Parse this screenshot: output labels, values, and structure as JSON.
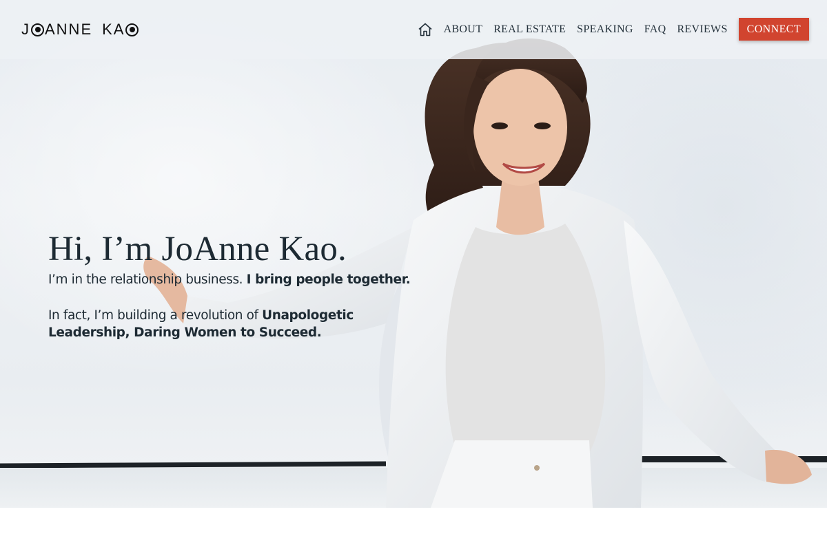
{
  "brand": {
    "logo_text_1": "J",
    "logo_text_2": "ANNE",
    "logo_text_3": "KA",
    "accent_color": "#d1442f"
  },
  "nav": {
    "home_icon": "home-icon",
    "items": [
      {
        "label": "ABOUT"
      },
      {
        "label": "REAL ESTATE"
      },
      {
        "label": "SPEAKING"
      },
      {
        "label": "FAQ"
      },
      {
        "label": "REVIEWS"
      }
    ],
    "cta_label": "CONNECT"
  },
  "hero": {
    "title": "Hi, I’m JoAnne Kao.",
    "line1_regular": "I’m in the relationship business. ",
    "line1_bold": "I bring people together.",
    "line2_regular": "In fact, I’m building a revolution of ",
    "line2_bold": "Unapologetic Leadership, Daring Women to Succeed."
  }
}
